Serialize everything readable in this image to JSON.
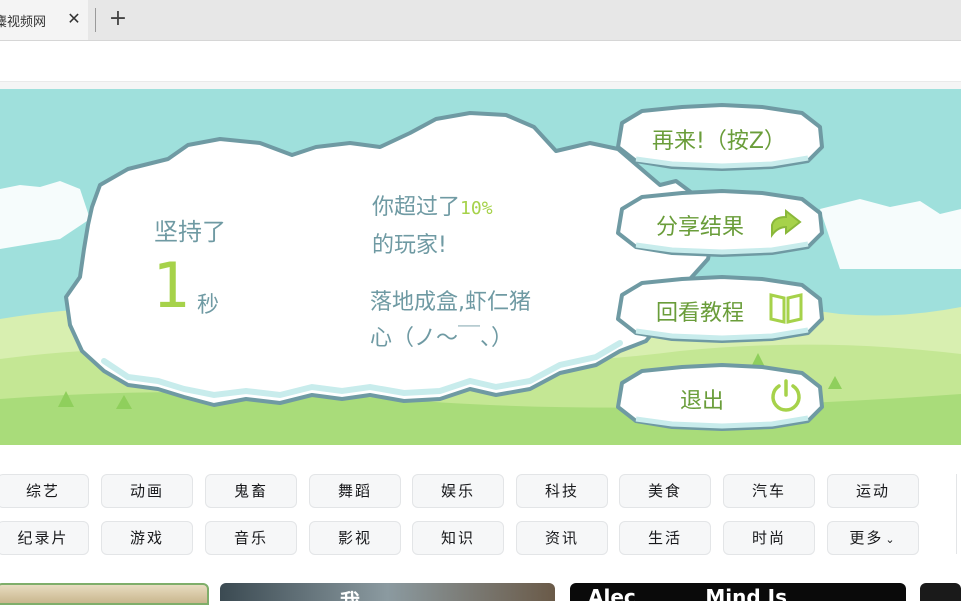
{
  "tab": {
    "title": "麋视频网",
    "close_glyph": "✕",
    "new_glyph": "+"
  },
  "game": {
    "persist_label": "坚持了",
    "seconds": "1",
    "seconds_unit": "秒",
    "beat_prefix": "你超过了",
    "beat_percent": "10%",
    "beat_suffix": "的玩家!",
    "comment_line1": "落地成盒,虾仁猪",
    "comment_line2": "心（ノ〜￣、）",
    "buttons": {
      "retry": "再来!（按Z）",
      "share": "分享结果",
      "tutorial": "回看教程",
      "exit": "退出"
    }
  },
  "categories": {
    "row1": [
      "综艺",
      "动画",
      "鬼畜",
      "舞蹈",
      "娱乐",
      "科技",
      "美食",
      "汽车",
      "运动"
    ],
    "row2": [
      "纪录片",
      "游戏",
      "音乐",
      "影视",
      "知识",
      "资讯",
      "生活",
      "时尚",
      "更多"
    ]
  },
  "thumbs": [
    {
      "text": ""
    },
    {
      "text": "我"
    },
    {
      "text": "Alec          Mind Is"
    },
    {
      "text": ""
    }
  ],
  "colors": {
    "sky": "#9fe0dc",
    "grass": "#a9dc7a",
    "cloud_outline": "#6f9aa3",
    "accent_green": "#a6d24a",
    "text_teal": "#6f9aa3"
  }
}
